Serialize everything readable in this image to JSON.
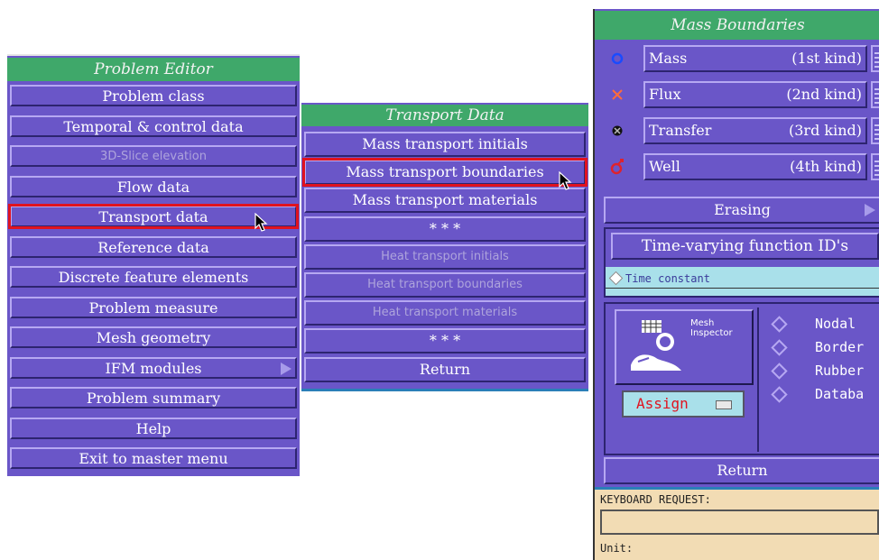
{
  "problem_editor": {
    "title": "Problem Editor",
    "items": [
      {
        "label": "Problem class",
        "state": "normal"
      },
      {
        "label": "Temporal & control data",
        "state": "normal"
      },
      {
        "label": "3D-Slice elevation",
        "state": "disabled"
      },
      {
        "label": "Flow data",
        "state": "normal"
      },
      {
        "label": "Transport data",
        "state": "highlighted"
      },
      {
        "label": "Reference data",
        "state": "normal"
      },
      {
        "label": "Discrete feature elements",
        "state": "normal"
      },
      {
        "label": "Problem measure",
        "state": "normal"
      },
      {
        "label": "Mesh geometry",
        "state": "normal"
      },
      {
        "label": "IFM modules",
        "state": "submenu"
      },
      {
        "label": "Problem summary",
        "state": "normal"
      },
      {
        "label": "Help",
        "state": "normal"
      },
      {
        "label": "Exit to master menu",
        "state": "normal"
      }
    ]
  },
  "transport_data": {
    "title": "Transport Data",
    "items": [
      {
        "label": "Mass transport initials",
        "state": "normal"
      },
      {
        "label": "Mass transport boundaries",
        "state": "highlighted"
      },
      {
        "label": "Mass transport materials",
        "state": "normal"
      },
      {
        "label": "* * *",
        "state": "normal"
      },
      {
        "label": "Heat transport initials",
        "state": "disabled"
      },
      {
        "label": "Heat transport boundaries",
        "state": "disabled"
      },
      {
        "label": "Heat transport materials",
        "state": "disabled"
      },
      {
        "label": "* * *",
        "state": "normal"
      },
      {
        "label": "Return",
        "state": "normal"
      }
    ]
  },
  "mass_boundaries": {
    "title": "Mass Boundaries",
    "rows": [
      {
        "icon": "circle-icon",
        "name": "Mass",
        "kind": "(1st kind)",
        "color": "#1a4bff"
      },
      {
        "icon": "cross-icon",
        "name": "Flux",
        "kind": "(2nd kind)",
        "color": "#ff6b3a"
      },
      {
        "icon": "cross-circle-icon",
        "name": "Transfer",
        "kind": "(3rd kind)",
        "color": "#111111"
      },
      {
        "icon": "well-icon",
        "name": "Well",
        "kind": "(4th kind)",
        "color": "#e0222c"
      }
    ],
    "erasing_label": "Erasing",
    "time_varying_label": "Time-varying function ID's",
    "time_constant_label": "Time constant",
    "mesh_inspector_label": "Mesh\nInspector",
    "mesh_inspector_line1": "Mesh",
    "mesh_inspector_line2": "Inspector",
    "assign_label": "Assign",
    "radio_options": [
      "Nodal",
      "Border",
      "Rubber",
      "Databa"
    ],
    "return_label": "Return",
    "keyboard_request_label": "KEYBOARD REQUEST:",
    "unit_label": "Unit:"
  },
  "colors": {
    "panel": "#6a56c8",
    "title_bar": "#3fa86a",
    "highlight": "#e0131f",
    "info_bar": "#f2dcb4"
  }
}
